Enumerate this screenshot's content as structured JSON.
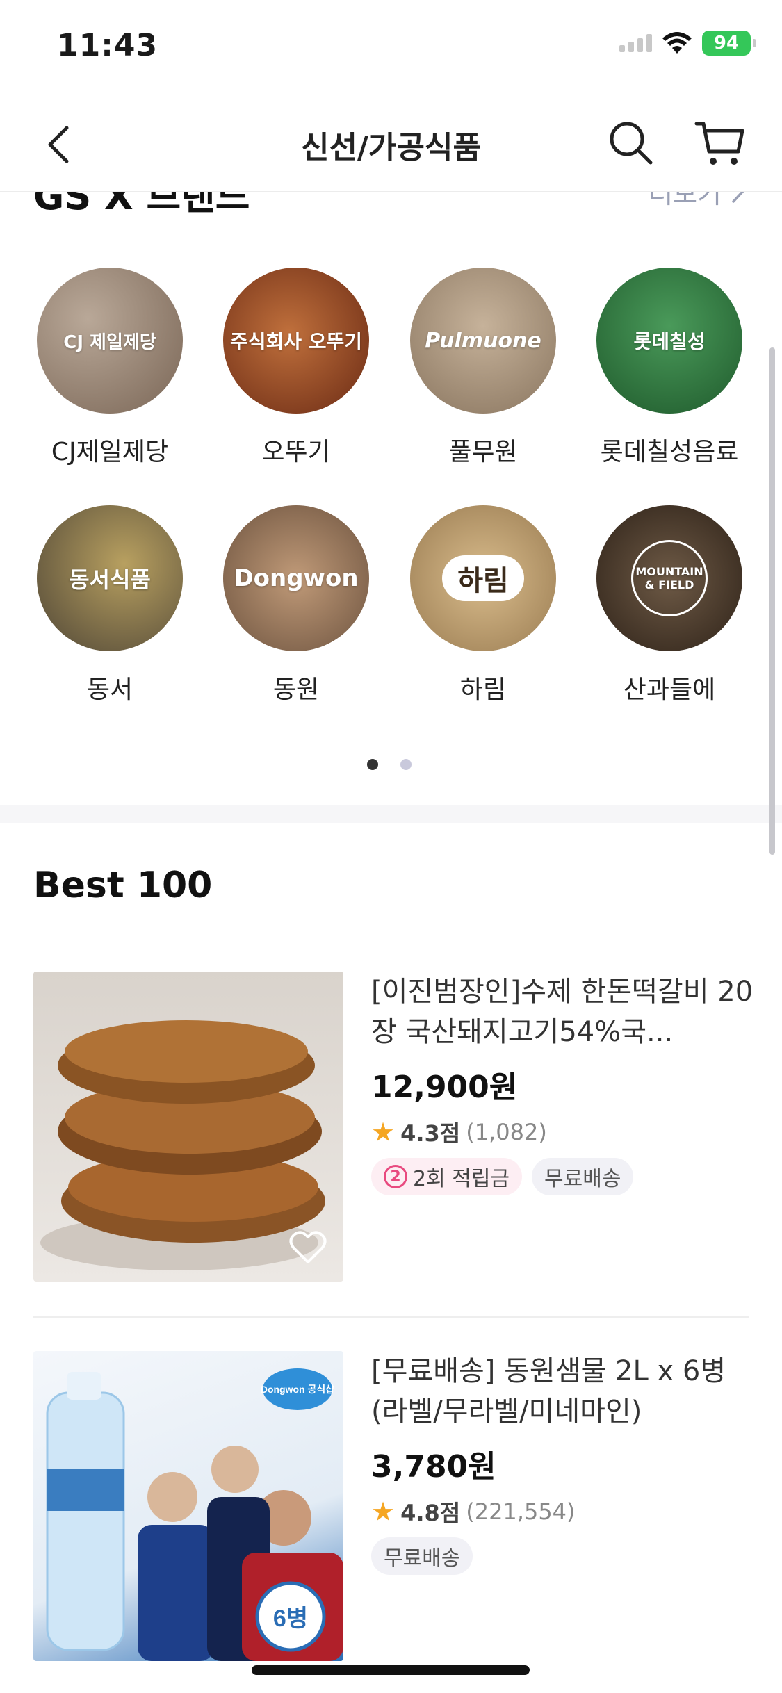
{
  "status": {
    "time": "11:43",
    "battery": "94"
  },
  "nav": {
    "title": "신선/가공식품"
  },
  "brand_section": {
    "title": "GS X 브랜드",
    "more_label": "더보기",
    "brands": [
      {
        "name": "CJ제일제당",
        "logo": "CJ 제일제당",
        "color": "#8d7a6a"
      },
      {
        "name": "오뚜기",
        "logo": "주식회사 오뚜기",
        "color": "#8a3d1e"
      },
      {
        "name": "풀무원",
        "logo": "Pulmuone",
        "color": "#b09a80"
      },
      {
        "name": "롯데칠성음료",
        "logo": "롯데칠성",
        "color": "#2f7a3e"
      },
      {
        "name": "동서",
        "logo": "동서식품",
        "color": "#6e6654"
      },
      {
        "name": "동원",
        "logo": "Dongwon",
        "color": "#9a7b62"
      },
      {
        "name": "하림",
        "logo": "하림",
        "color": "#c2a27a"
      },
      {
        "name": "산과들에",
        "logo": "MOUNTAIN & FIELD",
        "color": "#4a3a2c"
      }
    ]
  },
  "best": {
    "title": "Best 100",
    "products": [
      {
        "name": "[이진범장인]수제 한돈떡갈비 20장 국산돼지고기54%국...",
        "price": "12,900원",
        "score": "4.3점",
        "count": "(1,082)",
        "points_badge": "2회 적립금",
        "points_num": "2",
        "shipping_badge": "무료배송"
      },
      {
        "name": "[무료배송] 동원샘물 2L x 6병 (라벨/무라벨/미네마인)",
        "price": "3,780원",
        "score": "4.8점",
        "count": "(221,554)",
        "shipping_badge": "무료배송",
        "thumb_logo": "Dongwon 공식샵",
        "thumb_badge": "6병"
      }
    ]
  }
}
